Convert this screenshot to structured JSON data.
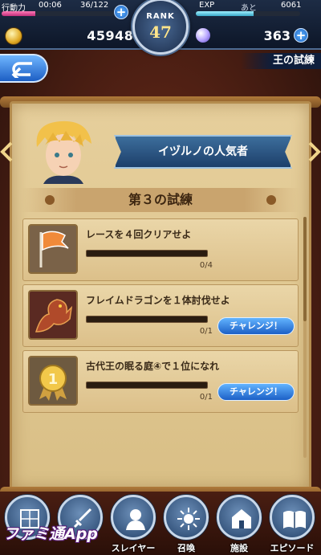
{
  "header": {
    "stamina": {
      "label": "行動力",
      "timer": "00:06",
      "value": "36/122",
      "fill": 0.3
    },
    "exp": {
      "label": "EXP",
      "next_label": "あと",
      "value": "6061",
      "fill": 0.55
    },
    "rank": {
      "label": "RANK",
      "value": "47"
    },
    "coins": "459489",
    "gems": "363"
  },
  "subheader": {
    "title": "王の試練"
  },
  "event": {
    "name": "イヅルノの人気者"
  },
  "trial": {
    "title": "第３の試練"
  },
  "missions": [
    {
      "text": "レースを４回クリアせよ",
      "progress": "0/4",
      "fill": 0,
      "icon": "flag-icon",
      "has_button": false
    },
    {
      "text": "フレイムドラゴンを１体討伐せよ",
      "progress": "0/1",
      "fill": 0,
      "icon": "dragon-icon",
      "has_button": true
    },
    {
      "text": "古代王の眠る庭④で１位になれ",
      "progress": "0/1",
      "fill": 0,
      "icon": "medal-icon",
      "has_button": true
    }
  ],
  "challenge_label": "チャレンジ！",
  "nav": [
    {
      "label": "",
      "icon": "map-icon"
    },
    {
      "label": "",
      "icon": "sword-icon"
    },
    {
      "label": "スレイヤー",
      "icon": "slayer-icon"
    },
    {
      "label": "召喚",
      "icon": "summon-icon"
    },
    {
      "label": "施設",
      "icon": "facility-icon"
    },
    {
      "label": "エピソード",
      "icon": "book-icon"
    }
  ],
  "watermark": "ファミ通App",
  "colors": {
    "accent_blue": "#1c60c6",
    "parchment": "#e6cf9c",
    "stamina_pink": "#ff79b6",
    "exp_cyan": "#9ff0ff"
  }
}
